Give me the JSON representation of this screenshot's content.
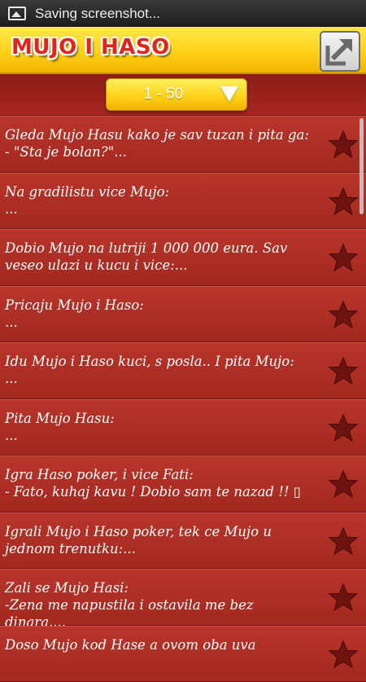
{
  "status_bar": {
    "notification_icon": "image-icon",
    "text": "Saving screenshot..."
  },
  "header": {
    "title": "MUJO I HASO",
    "share_icon": "share-icon"
  },
  "page_selector": {
    "value": "1 - 50",
    "icon": "dropdown-arrow-icon"
  },
  "colors": {
    "header_yellow": "#ffd11a",
    "title_red": "#e1251b",
    "list_red": "#a82a22",
    "star_dark": "#6e1410"
  },
  "jokes": [
    {
      "text": "Gleda Mujo Hasu kako je sav tuzan i pita ga:\n- \"Sta je bolan?\"..."
    },
    {
      "text": "Na gradilistu vice Mujo:\n..."
    },
    {
      "text": "Dobio Mujo na lutriji 1 000 000 eura. Sav veseo ulazi u kucu i vice:..."
    },
    {
      "text": "Pricaju Mujo i Haso:\n..."
    },
    {
      "text": "Idu Mujo i Haso kuci, s posla.. I pita Mujo:\n..."
    },
    {
      "text": "Pita Mujo Hasu:\n..."
    },
    {
      "text": "Igra Haso poker, i vice Fati:\n- Fato, kuhaj kavu ! Dobio sam te nazad !! ▯"
    },
    {
      "text": "Igrali Mujo i Haso poker, tek ce Mujo u jednom trenutku:..."
    },
    {
      "text": "Zali se Mujo Hasi:\n-Zena me napustila i ostavila me bez dinara...."
    },
    {
      "text": "Doso Mujo kod Hase a ovom oba uva"
    }
  ]
}
